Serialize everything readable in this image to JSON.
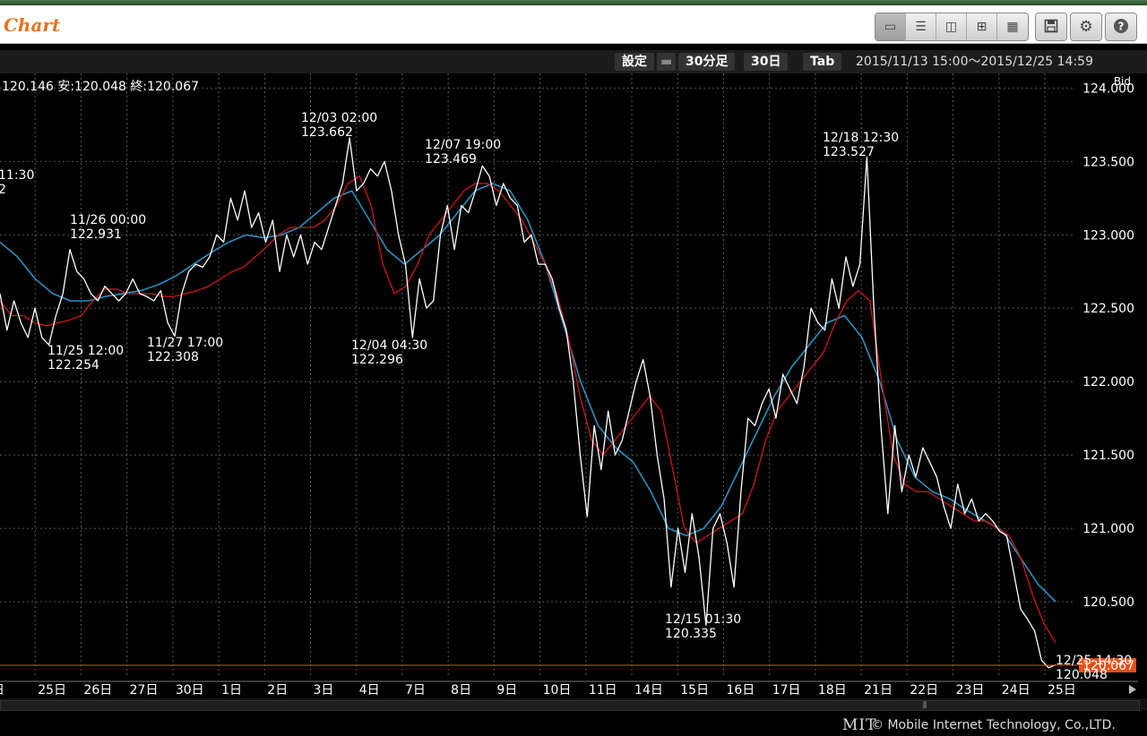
{
  "app_title": "Chart",
  "toolbar": {
    "layout_buttons": [
      {
        "name": "layout-single-icon",
        "glyph": "▭",
        "active": true
      },
      {
        "name": "layout-two-row-icon",
        "glyph": "☰",
        "active": false
      },
      {
        "name": "layout-two-col-icon",
        "glyph": "◫",
        "active": false
      },
      {
        "name": "layout-four-icon",
        "glyph": "⊞",
        "active": false
      },
      {
        "name": "layout-many-icon",
        "glyph": "▦",
        "active": false
      }
    ],
    "save_icon": "save-icon",
    "settings_icon": "gear-icon",
    "help_icon": "help-icon"
  },
  "controls": {
    "settings_label": "設定",
    "interval_label": "30分足",
    "period_label": "30日",
    "tab_label": "Tab",
    "date_range": "2015/11/13 15:00～2015/12/25 14:59"
  },
  "footer": {
    "logo": "MIT",
    "copyright": "© Mobile Internet Technology, Co.,LTD."
  },
  "colors": {
    "background": "#000000",
    "price_line": "#ffffff",
    "ma_short": "#c0161c",
    "ma_long": "#2a8fbd",
    "current_price": "#e8501a",
    "grid": "#5a5a5a"
  },
  "chart_data": {
    "type": "line",
    "ohlc_label": "120.146 安:120.048 終:120.067",
    "price_type_label": "Bid",
    "ylim": [
      120.0,
      124.1
    ],
    "y_ticks": [
      "124.000",
      "123.500",
      "123.000",
      "122.500",
      "122.000",
      "121.500",
      "121.000",
      "120.500"
    ],
    "x_ticks": [
      "日",
      "25日",
      "26日",
      "27日",
      "30日",
      "1日",
      "2日",
      "3日",
      "4日",
      "7日",
      "8日",
      "9日",
      "10日",
      "11日",
      "14日",
      "15日",
      "16日",
      "17日",
      "18日",
      "21日",
      "22日",
      "23日",
      "24日",
      "25日"
    ],
    "current_price": "120.067",
    "annotations": [
      {
        "time": "11:30",
        "value": "2",
        "position": "above"
      },
      {
        "time": "11/26 00:00",
        "value": "122.931",
        "position": "above"
      },
      {
        "time": "11/25 12:00",
        "value": "122.254",
        "position": "below"
      },
      {
        "time": "11/27 17:00",
        "value": "122.308",
        "position": "below"
      },
      {
        "time": "12/03 02:00",
        "value": "123.662",
        "position": "above"
      },
      {
        "time": "12/07 19:00",
        "value": "123.469",
        "position": "above"
      },
      {
        "time": "12/04 04:30",
        "value": "122.296",
        "position": "below"
      },
      {
        "time": "12/18 12:30",
        "value": "123.527",
        "position": "above"
      },
      {
        "time": "12/15 01:30",
        "value": "120.335",
        "position": "below"
      },
      {
        "time": "12/25 14:30",
        "value": "120.048",
        "position": "below"
      }
    ],
    "price_series": {
      "values": [
        122.6,
        122.35,
        122.55,
        122.4,
        122.3,
        122.5,
        122.3,
        122.25,
        122.45,
        122.6,
        122.9,
        122.75,
        122.7,
        122.6,
        122.55,
        122.65,
        122.6,
        122.55,
        122.6,
        122.7,
        122.6,
        122.58,
        122.55,
        122.62,
        122.4,
        122.31,
        122.6,
        122.75,
        122.8,
        122.78,
        122.85,
        123.0,
        122.95,
        123.25,
        123.1,
        123.3,
        123.05,
        123.15,
        122.95,
        123.1,
        122.75,
        123.0,
        122.85,
        123.0,
        122.8,
        122.95,
        122.9,
        123.05,
        123.2,
        123.35,
        123.66,
        123.3,
        123.35,
        123.45,
        123.4,
        123.5,
        123.3,
        123.0,
        122.8,
        122.3,
        122.7,
        122.5,
        122.55,
        123.0,
        123.2,
        122.9,
        123.2,
        123.15,
        123.3,
        123.47,
        123.4,
        123.2,
        123.35,
        123.25,
        123.2,
        122.95,
        123.0,
        122.8,
        122.8,
        122.7,
        122.5,
        122.35,
        122.0,
        121.5,
        121.08,
        121.7,
        121.4,
        121.8,
        121.5,
        121.6,
        121.8,
        122.0,
        122.15,
        121.9,
        121.5,
        121.2,
        120.6,
        121.0,
        120.7,
        121.1,
        120.8,
        120.34,
        121.0,
        121.1,
        120.9,
        120.6,
        121.25,
        121.75,
        121.7,
        121.85,
        121.95,
        121.75,
        122.05,
        121.95,
        121.85,
        122.1,
        122.5,
        122.4,
        122.35,
        122.7,
        122.5,
        122.85,
        122.65,
        122.8,
        123.53,
        122.5,
        121.7,
        121.1,
        121.7,
        121.25,
        121.5,
        121.35,
        121.55,
        121.45,
        121.35,
        121.15,
        121.0,
        121.3,
        121.1,
        121.2,
        121.05,
        121.1,
        121.05,
        120.98,
        120.95,
        120.7,
        120.45,
        120.38,
        120.3,
        120.1,
        120.05,
        120.07
      ]
    },
    "ma_short": {
      "values": [
        122.55,
        122.45,
        122.45,
        122.4,
        122.38,
        122.4,
        122.42,
        122.45,
        122.55,
        122.63,
        122.63,
        122.6,
        122.6,
        122.6,
        122.58,
        122.58,
        122.6,
        122.62,
        122.65,
        122.7,
        122.75,
        122.78,
        122.85,
        122.92,
        123.0,
        123.05,
        123.05,
        123.05,
        123.1,
        123.2,
        123.35,
        123.4,
        123.2,
        122.8,
        122.6,
        122.65,
        122.8,
        123.0,
        123.1,
        123.2,
        123.3,
        123.35,
        123.35,
        123.3,
        123.2,
        123.1,
        122.95,
        122.8,
        122.6,
        122.3,
        121.9,
        121.6,
        121.5,
        121.6,
        121.7,
        121.8,
        121.9,
        121.8,
        121.4,
        121.0,
        120.9,
        120.95,
        121.0,
        121.05,
        121.1,
        121.3,
        121.6,
        121.8,
        121.9,
        122.0,
        122.1,
        122.2,
        122.4,
        122.55,
        122.62,
        122.55,
        122.0,
        121.5,
        121.3,
        121.25,
        121.25,
        121.2,
        121.15,
        121.1,
        121.05,
        121.05,
        121.0,
        120.95,
        120.8,
        120.55,
        120.35,
        120.22
      ]
    },
    "ma_long": {
      "values": [
        122.95,
        122.85,
        122.7,
        122.6,
        122.55,
        122.55,
        122.58,
        122.6,
        122.62,
        122.66,
        122.72,
        122.8,
        122.88,
        122.95,
        123.0,
        122.98,
        123.0,
        123.05,
        123.15,
        123.25,
        123.3,
        123.1,
        122.9,
        122.8,
        122.9,
        123.0,
        123.15,
        123.3,
        123.35,
        123.3,
        123.1,
        122.8,
        122.4,
        122.0,
        121.7,
        121.55,
        121.45,
        121.25,
        121.0,
        120.95,
        121.0,
        121.15,
        121.4,
        121.65,
        121.9,
        122.1,
        122.25,
        122.4,
        122.45,
        122.3,
        122.0,
        121.6,
        121.35,
        121.25,
        121.2,
        121.12,
        121.05,
        120.98,
        120.8,
        120.62,
        120.5
      ]
    }
  }
}
